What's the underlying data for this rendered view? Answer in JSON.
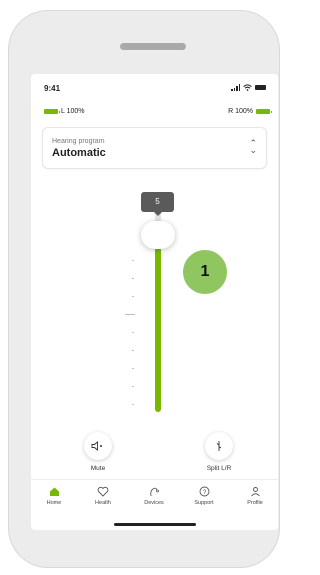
{
  "status_bar": {
    "time": "9:41"
  },
  "battery": {
    "left_label": "L 100%",
    "right_label": "R 100%",
    "left_level": 1.0,
    "right_level": 1.0,
    "color": "#7ab800"
  },
  "program": {
    "label": "Hearing program",
    "value": "Automatic",
    "chevron_icon": "chevron-updown-icon"
  },
  "volume": {
    "value": "5",
    "level_fraction": 0.82,
    "accent_color": "#7ab800"
  },
  "callout": {
    "number": "1",
    "color": "#8fc660"
  },
  "actions": [
    {
      "label": "Mute",
      "icon": "speaker-mute-icon"
    },
    {
      "label": "Split L/R",
      "icon": "split-icon"
    }
  ],
  "tabs": [
    {
      "label": "Home",
      "icon": "home-icon",
      "active": true
    },
    {
      "label": "Health",
      "icon": "heart-icon",
      "active": false
    },
    {
      "label": "Devices",
      "icon": "hearing-aid-icon",
      "active": false
    },
    {
      "label": "Support",
      "icon": "question-icon",
      "active": false
    },
    {
      "label": "Profile",
      "icon": "person-icon",
      "active": false
    }
  ]
}
